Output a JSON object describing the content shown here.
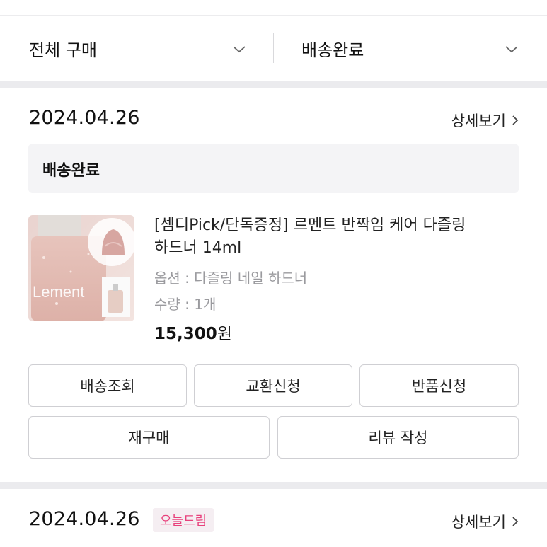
{
  "filters": {
    "purchase_type": "전체 구매",
    "status": "배송완료"
  },
  "orders": [
    {
      "date": "2024.04.26",
      "detail_label": "상세보기",
      "status": "배송완료",
      "product": {
        "name": "[셈디Pick/단독증정] 르멘트 반짝임 케어 다즐링 하드너 14ml",
        "option": "옵션 : 다즐링 네일 하드너",
        "quantity": "수량 : 1개",
        "price_number": "15,300",
        "price_unit": "원",
        "thumb_text": "Lement"
      },
      "buttons": [
        "배송조회",
        "교환신청",
        "반품신청",
        "재구매",
        "리뷰 작성"
      ]
    },
    {
      "date": "2024.04.26",
      "badge": "오늘드림",
      "detail_label": "상세보기"
    }
  ],
  "colors": {
    "badge_text": "#e8417c",
    "badge_bg": "#f5eef2",
    "separator_band": "#ebebee",
    "status_box": "#f4f4f6"
  }
}
